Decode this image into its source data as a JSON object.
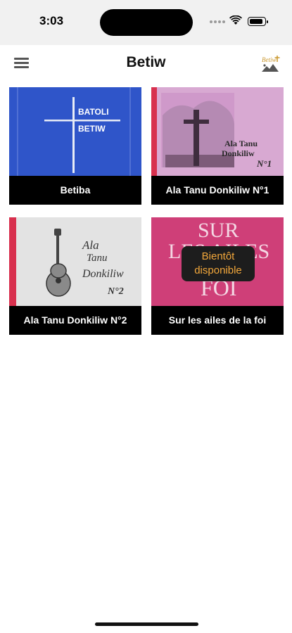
{
  "status_bar": {
    "time": "3:03"
  },
  "header": {
    "title": "Betiw",
    "menu_icon": "hamburger-menu-icon",
    "logo_text": "Betiw"
  },
  "books": [
    {
      "label": "Betiba",
      "cover_lines": [
        "BATOLI",
        "BETIW"
      ],
      "cover_color": "#2f55c9",
      "available": true
    },
    {
      "label": "Ala Tanu Donkiliw N°1",
      "cover_lines": [
        "Ala Tanu",
        "Donkiliw",
        "N°1"
      ],
      "cover_color": "#d8a9d2",
      "available": true
    },
    {
      "label": "Ala Tanu Donkiliw N°2",
      "cover_lines": [
        "Ala",
        "Tanu",
        "Donkiliw",
        "N°2"
      ],
      "cover_color": "#e3e3e3",
      "available": true
    },
    {
      "label": "Sur les ailes de la foi",
      "cover_lines": [
        "SUR",
        "LES AILES",
        "FOI"
      ],
      "cover_color": "#cf3f78",
      "available": false,
      "badge": "Bientôt disponible"
    }
  ],
  "colors": {
    "badge_text": "#f2a73b",
    "badge_background": "#1d1d1d",
    "label_background": "#000000"
  }
}
